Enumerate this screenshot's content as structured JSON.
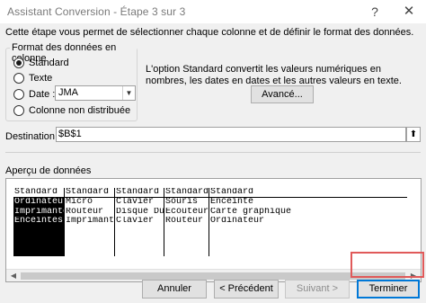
{
  "window": {
    "title": "Assistant Conversion - Étape 3 sur 3",
    "help_glyph": "?",
    "close_glyph": "✕"
  },
  "intro": "Cette étape vous permet de sélectionner chaque colonne et de définir le format des données.",
  "column_format": {
    "group_label": "Format des données en colonne",
    "options": [
      {
        "label": "Standard",
        "checked": true
      },
      {
        "label": "Texte",
        "checked": false
      },
      {
        "label": "Date :",
        "checked": false
      },
      {
        "label": "Colonne non distribuée",
        "checked": false
      }
    ],
    "date_format": {
      "value": "JMA",
      "options": [
        "JMA"
      ]
    }
  },
  "description": "L'option Standard convertit les valeurs numériques en nombres, les dates en dates et les autres valeurs en texte.",
  "advanced_button": "Avancé...",
  "destination": {
    "label": "Destination :",
    "value": "$B$1",
    "picker_icon": "range-picker-icon"
  },
  "preview": {
    "label": "Aperçu de données",
    "columns": [
      {
        "header": "Standard",
        "cells": [
          "Ordinateur",
          "Imprimante",
          "Enceintes"
        ],
        "selected": true
      },
      {
        "header": "Standard",
        "cells": [
          "Micro",
          "Routeur",
          "Imprimante"
        ],
        "selected": false
      },
      {
        "header": "Standard",
        "cells": [
          "Clavier",
          "Disque Dur",
          "Clavier"
        ],
        "selected": false
      },
      {
        "header": "Standard",
        "cells": [
          "Souris",
          "Ecouteurs",
          "Routeur"
        ],
        "selected": false
      },
      {
        "header": "Standard",
        "cells": [
          "Enceinte",
          "Carte graphique",
          "Ordinateur"
        ],
        "selected": false
      }
    ]
  },
  "buttons": {
    "cancel": "Annuler",
    "previous": "< Précédent",
    "next": "Suivant >",
    "finish": "Terminer"
  },
  "colors": {
    "highlight": "#e05a5a",
    "focus": "#0078d7",
    "dialog_bg": "#f0f0f0"
  }
}
